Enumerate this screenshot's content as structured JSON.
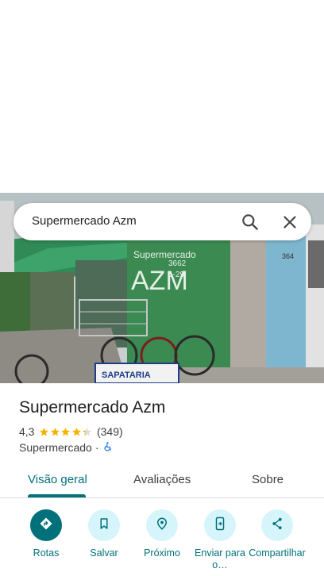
{
  "search": {
    "query": "Supermercado Azm"
  },
  "place": {
    "name": "Supermercado Azm",
    "rating": "4,3",
    "stars_value": 4.3,
    "review_count": "(349)",
    "category": "Supermercado",
    "separator": "·"
  },
  "photo_signs": {
    "store_sign": "Supermercado",
    "store_sign_big": "AZM",
    "address": "3662",
    "address_2": "1-29",
    "number_on_wall": "364",
    "shop_sign": "SAPATARIA"
  },
  "tabs": [
    {
      "label": "Visão geral",
      "active": true
    },
    {
      "label": "Avaliações",
      "active": false
    },
    {
      "label": "Sobre",
      "active": false
    }
  ],
  "actions": [
    {
      "label": "Rotas",
      "icon": "directions-icon"
    },
    {
      "label": "Salvar",
      "icon": "bookmark-icon"
    },
    {
      "label": "Próximo",
      "icon": "nearby-icon"
    },
    {
      "label": "Enviar para o…",
      "icon": "send-to-phone-icon"
    },
    {
      "label": "Compartilhar",
      "icon": "share-icon"
    }
  ],
  "colors": {
    "accent": "#00707a",
    "action_bg": "#d6f5fb",
    "star": "#f4b400",
    "wheelchair": "#1a73e8"
  }
}
